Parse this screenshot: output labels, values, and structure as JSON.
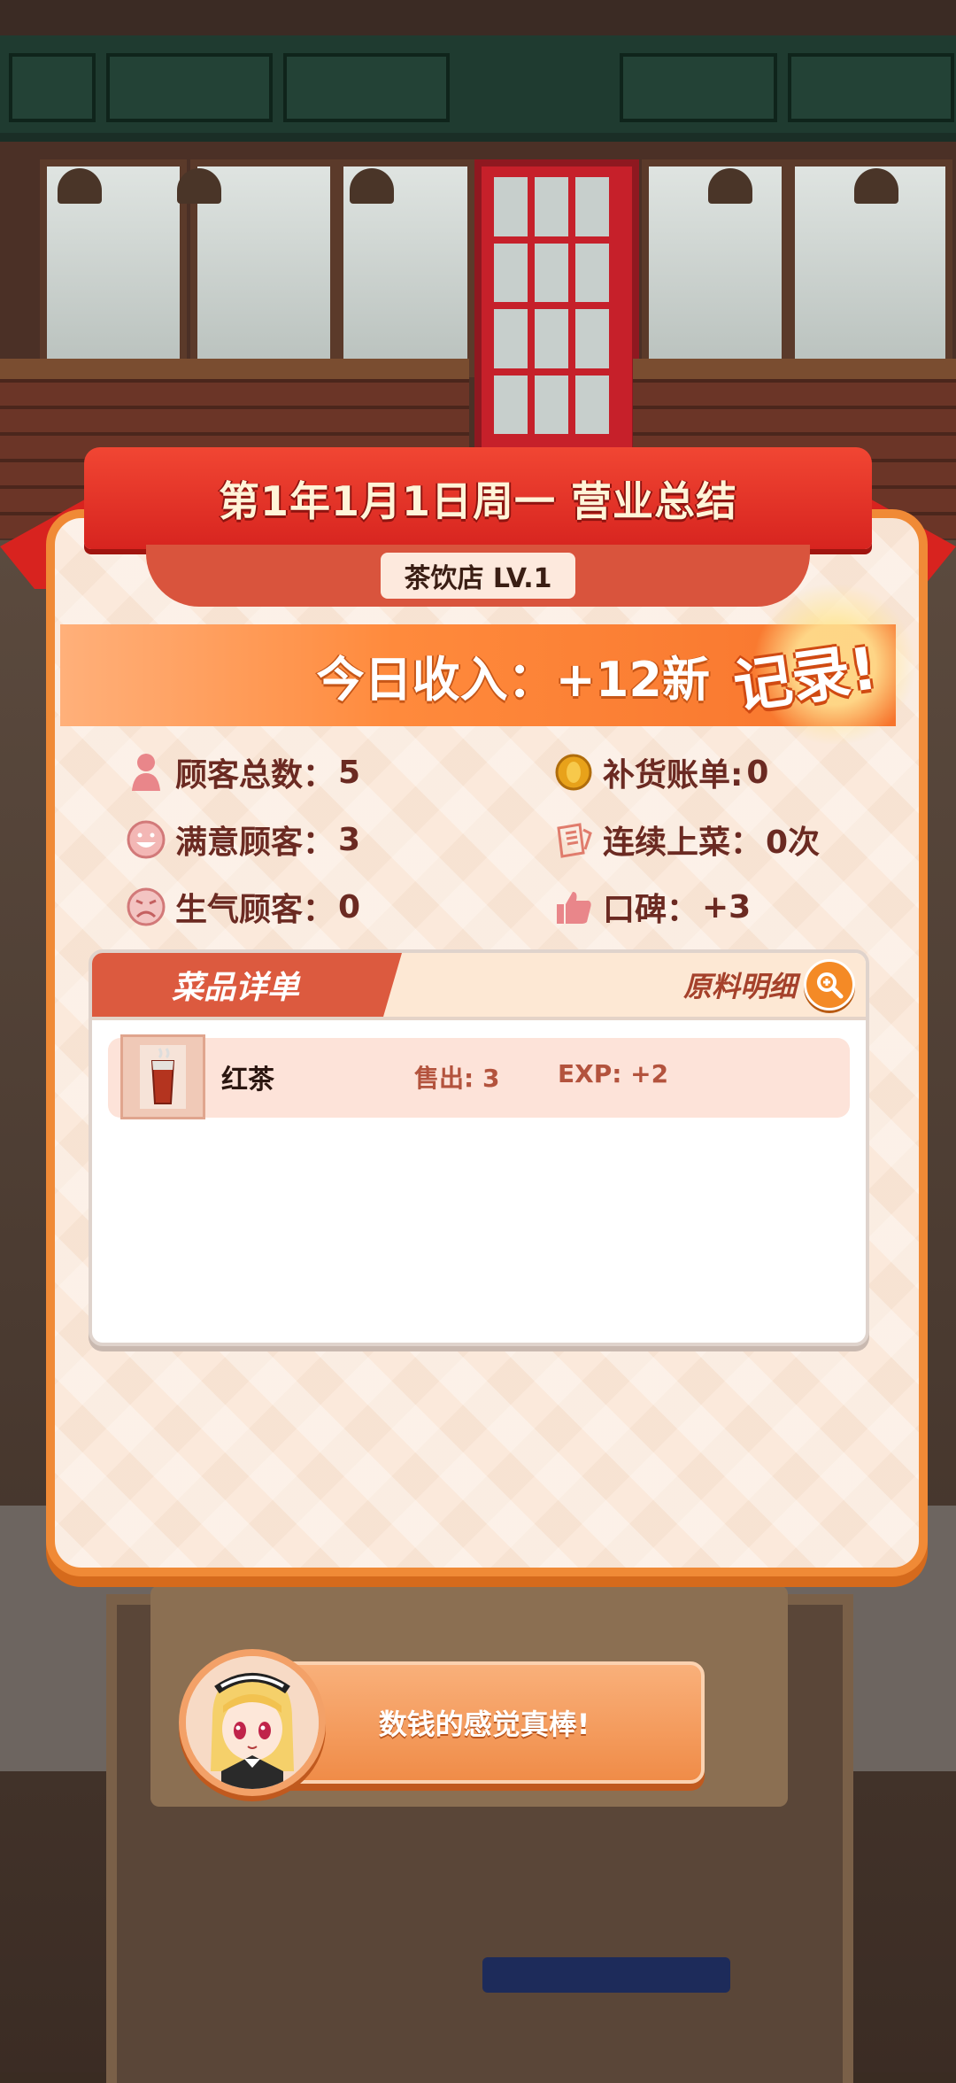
{
  "summary": {
    "title": "第1年1月1日周一 营业总结",
    "shop_label": "茶饮店  LV.1",
    "income_text": "今日收入：+12新",
    "record_text": "记录!"
  },
  "stats": {
    "customers_total_label": "顾客总数：",
    "customers_total_value": "5",
    "restock_bill_label": "补货账单:",
    "restock_bill_value": "0",
    "satisfied_label": "满意顾客：",
    "satisfied_value": "3",
    "streak_label": "连续上菜：",
    "streak_value": "0次",
    "angry_label": "生气顾客：",
    "angry_value": "0",
    "reputation_label": "口碑：",
    "reputation_value": "+3"
  },
  "dish_list": {
    "tab_title": "菜品详单",
    "ingredient_link": "原料明细",
    "items": [
      {
        "name": "红茶",
        "sold": "售出: 3",
        "exp": "EXP: +2"
      }
    ]
  },
  "speech": {
    "text": "数钱的感觉真棒!"
  },
  "colors": {
    "ribbon": "#d7241f",
    "panel_border": "#f08a36",
    "income_bar": "#f7742c",
    "dish_tab": "#dc5a3f",
    "stat_text": "#6b2a22"
  },
  "icons": [
    "person-icon",
    "coin-icon",
    "smile-icon",
    "serving-icon",
    "sad-icon",
    "thumbs-up-icon",
    "magnifier-plus-icon",
    "tea-cup-icon",
    "maid-avatar"
  ]
}
